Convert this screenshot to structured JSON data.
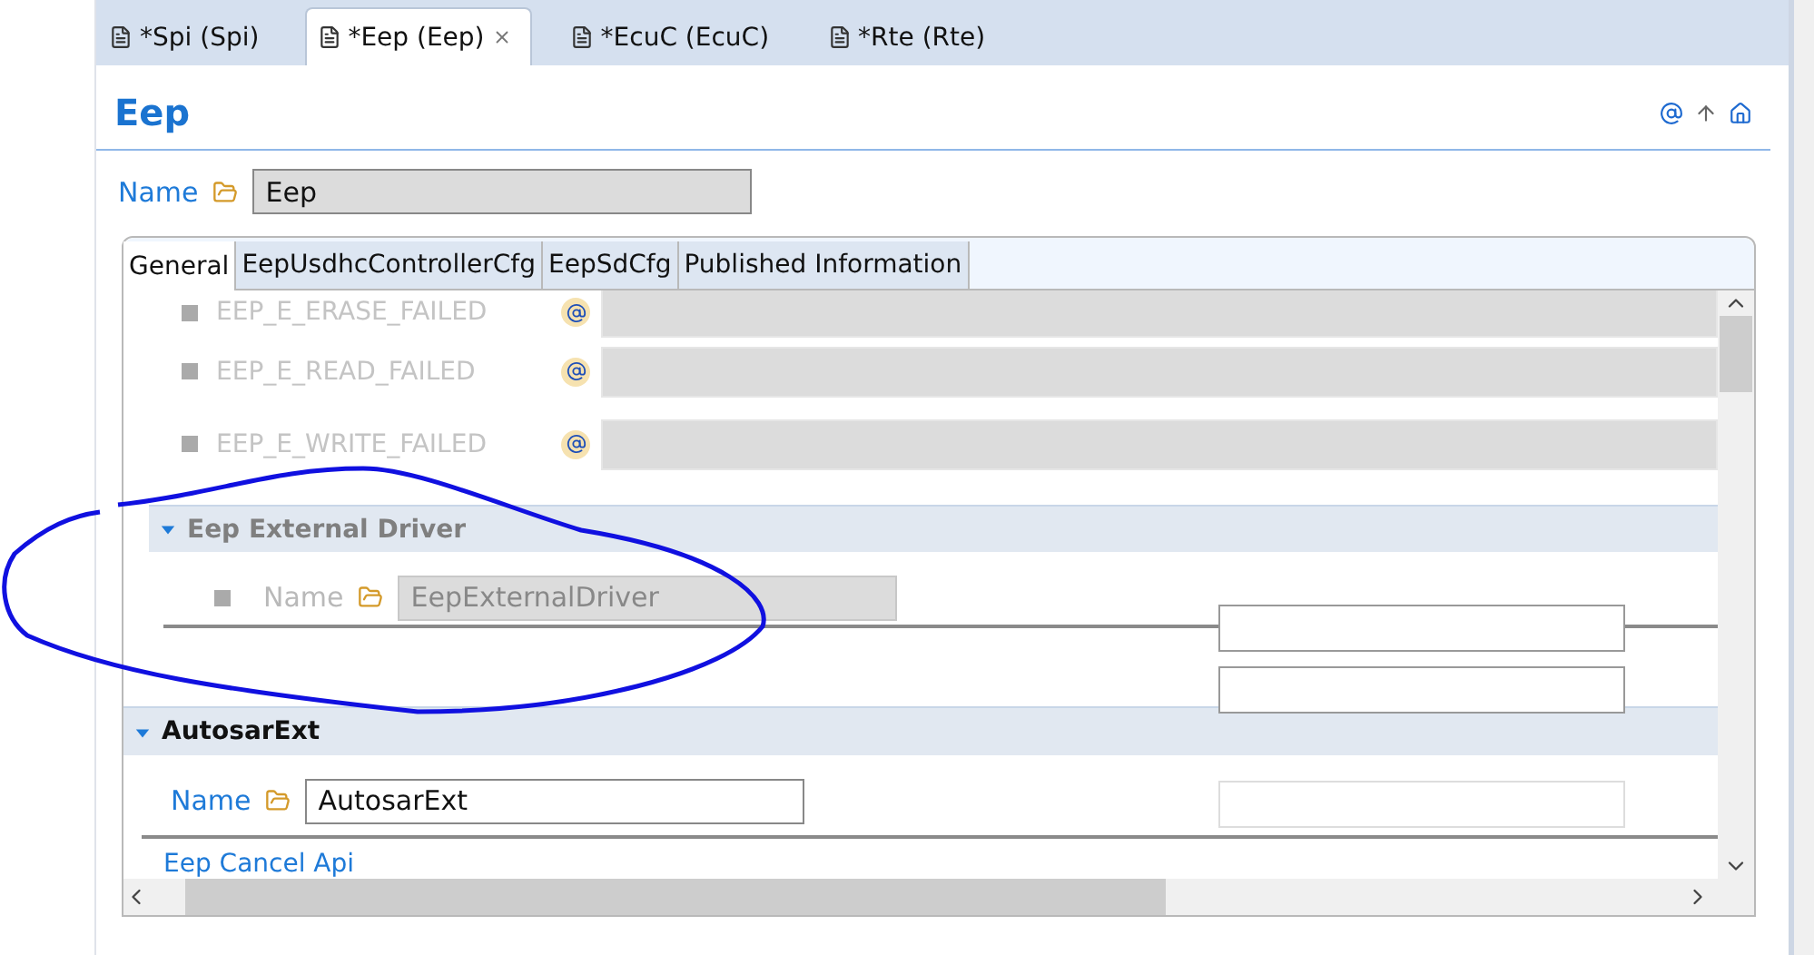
{
  "editor_tabs": [
    {
      "label": "*Spi (Spi)",
      "selected": false,
      "closable": false
    },
    {
      "label": "*Eep (Eep)",
      "selected": true,
      "closable": true
    },
    {
      "label": "*EcuC (EcuC)",
      "selected": false,
      "closable": false
    },
    {
      "label": "*Rte (Rte)",
      "selected": false,
      "closable": false
    }
  ],
  "header": {
    "title": "Eep"
  },
  "name_field": {
    "label": "Name",
    "value": "Eep"
  },
  "section_tabs": [
    {
      "label": "General",
      "selected": true
    },
    {
      "label": "EepUsdhcControllerCfg",
      "selected": false
    },
    {
      "label": "EepSdCfg",
      "selected": false
    },
    {
      "label": "Published Information",
      "selected": false
    }
  ],
  "parameters": [
    {
      "name": "EEP_E_ERASE_FAILED",
      "disabled": true
    },
    {
      "name": "EEP_E_READ_FAILED",
      "disabled": true
    },
    {
      "name": "EEP_E_WRITE_FAILED",
      "disabled": true
    }
  ],
  "subsections": [
    {
      "title": "Eep External Driver",
      "disabled": true,
      "expanded": true,
      "name_label": "Name",
      "name_value": "EepExternalDriver"
    },
    {
      "title": "AutosarExt",
      "disabled": false,
      "expanded": true,
      "name_label": "Name",
      "name_value": "AutosarExt"
    }
  ],
  "next_parameter": {
    "label": "Eep Cancel Api"
  }
}
